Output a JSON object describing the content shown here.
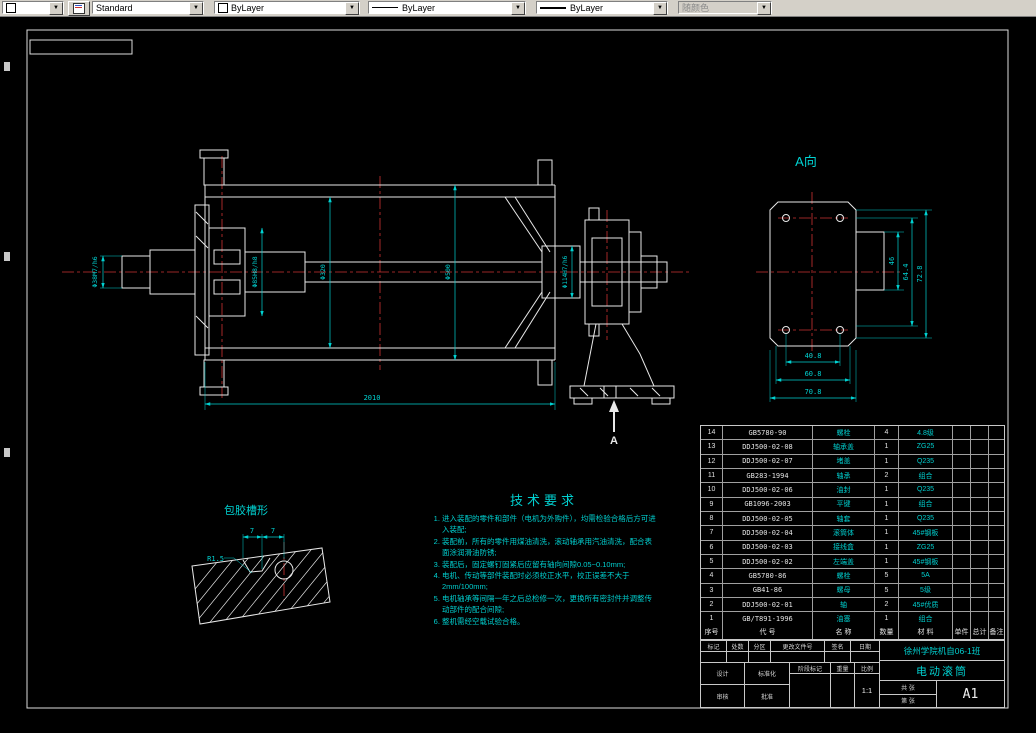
{
  "toolbar": {
    "style": "Standard",
    "color": "ByLayer",
    "linetype": "ByLayer",
    "lineweight": "ByLayer",
    "plotstyle": "随颜色",
    "arrow": "▼"
  },
  "views": {
    "a_view_label": "A向",
    "section_arrow_label": "A",
    "detail_label": "包胶槽形"
  },
  "dims": {
    "main": {
      "overall": "2010",
      "shaft_end": "Φ38M7/h6",
      "hub_bore": "Φ85H8/h8",
      "drum_inner": "Φ320",
      "drum_outer": "Φ500",
      "right_fit": "Φ114H7/h6"
    },
    "a_view": {
      "h_holes": "40.8",
      "h_mid": "60.8",
      "h_overall": "70.8",
      "v1": "46",
      "v2": "64.4",
      "v3": "72.8"
    },
    "detail": {
      "d1": "7",
      "d2": "7",
      "radius": "R1.5"
    }
  },
  "tech": {
    "title": "技术要求",
    "items": [
      "进入装配的零件和部件（电机为外购件），均需检验合格后方可进入装配;",
      "装配前，所有的零件用煤油清洗，滚动轴承用汽油清洗，配合表面涂润滑油防锈;",
      "装配后，固定螺钉固紧后应留有轴向间隙0.05~0.10mm;",
      "电机、传动等部件装配时必须校正水平，校正误差不大于2mm/100mm;",
      "电机轴承等间隔一年之后总检修一次，更换所有密封件并调整传动部件的配合间隙;",
      "整机需经空载试验合格。"
    ]
  },
  "parts": {
    "headers": [
      "序号",
      "代  号",
      "名  称",
      "数量",
      "材  料",
      "单件",
      "总计",
      "备注"
    ],
    "rows": [
      {
        "no": "14",
        "code": "GB5780-90",
        "name": "螺栓",
        "qty": "4",
        "mat": "4.8级"
      },
      {
        "no": "13",
        "code": "DDJ500-02-08",
        "name": "轴承盖",
        "qty": "1",
        "mat": "ZG25"
      },
      {
        "no": "12",
        "code": "DDJ500-02-07",
        "name": "堵盖",
        "qty": "1",
        "mat": "Q235"
      },
      {
        "no": "11",
        "code": "GB283-1994",
        "name": "轴承",
        "qty": "2",
        "mat": "组合"
      },
      {
        "no": "10",
        "code": "DDJ500-02-06",
        "name": "油封",
        "qty": "1",
        "mat": "Q235"
      },
      {
        "no": "9",
        "code": "GB1096-2003",
        "name": "平键",
        "qty": "1",
        "mat": "组合"
      },
      {
        "no": "8",
        "code": "DDJ500-02-05",
        "name": "轴套",
        "qty": "1",
        "mat": "Q235"
      },
      {
        "no": "7",
        "code": "DDJ500-02-04",
        "name": "滚筒体",
        "qty": "1",
        "mat": "45#钢板"
      },
      {
        "no": "6",
        "code": "DDJ500-02-03",
        "name": "接线盒",
        "qty": "1",
        "mat": "ZG25"
      },
      {
        "no": "5",
        "code": "DDJ500-02-02",
        "name": "左端盖",
        "qty": "1",
        "mat": "45#钢板"
      },
      {
        "no": "4",
        "code": "GB5780-86",
        "name": "螺栓",
        "qty": "5",
        "mat": "5A"
      },
      {
        "no": "3",
        "code": "GB41-86",
        "name": "螺母",
        "qty": "5",
        "mat": "5级"
      },
      {
        "no": "2",
        "code": "DDJ500-02-01",
        "name": "轴",
        "qty": "2",
        "mat": "45#优质"
      },
      {
        "no": "1",
        "code": "GB/T891-1996",
        "name": "油塞",
        "qty": "1",
        "mat": "组合"
      }
    ]
  },
  "titleblock": {
    "school": "徐州学院机自06-1班",
    "drawing_title": "电动滚筒",
    "sheet": "A1",
    "scale": "1:1",
    "row_labels": [
      "标记",
      "处数",
      "分区",
      "更改文件号",
      "签名",
      "日期"
    ],
    "sign_labels": [
      "设计",
      "标准化",
      "审核",
      "批准"
    ],
    "stage_labels": [
      "阶段标记",
      "重量",
      "比例"
    ],
    "sheet_labels": [
      "共 张",
      "第 张"
    ]
  },
  "colors": {
    "dim": "#00d2d2",
    "line": "#e8e8e8",
    "center": "#cc3333"
  }
}
